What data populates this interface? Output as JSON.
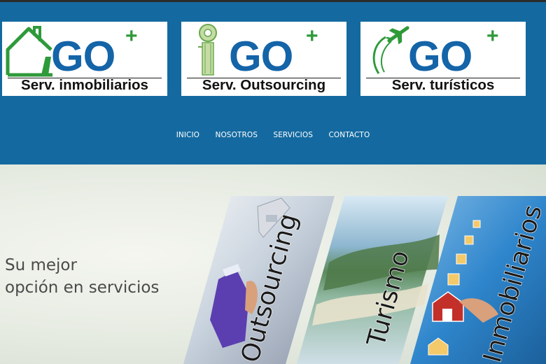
{
  "logos": [
    {
      "brand": "GO",
      "plus": "+",
      "subtitle": "Serv. inmobiliarios",
      "mark": "house-icon"
    },
    {
      "brand": "GO",
      "plus": "+",
      "subtitle": "Serv. Outsourcing",
      "mark": "tape-icon"
    },
    {
      "brand": "GO",
      "plus": "+",
      "subtitle": "Serv. turísticos",
      "mark": "airplane-icon"
    }
  ],
  "nav": {
    "items": [
      "INICIO",
      "NOSOTROS",
      "SERVICIOS",
      "CONTACTO"
    ]
  },
  "hero": {
    "tagline_line1": "Su mejor",
    "tagline_line2": "opción en servicios",
    "panels": [
      "Outsourcing",
      "Turismo",
      "Inmobiliarios"
    ]
  },
  "colors": {
    "header_bg": "#146aa0",
    "brand_blue": "#1464a8",
    "brand_green": "#2e9a3a",
    "hero_bg": "#e6ebe2"
  }
}
